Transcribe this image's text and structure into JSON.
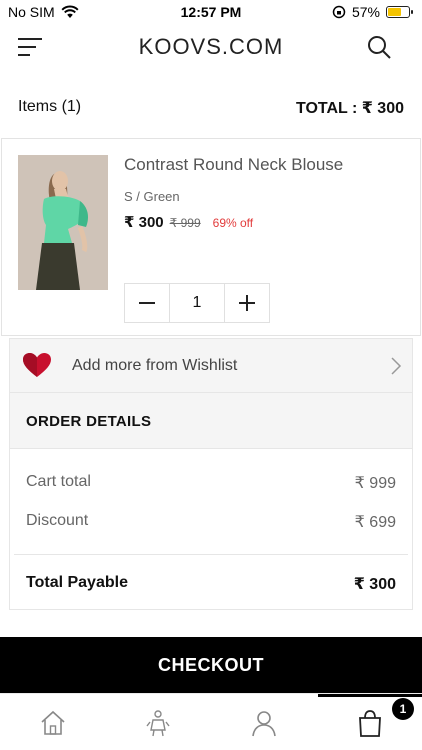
{
  "status_bar": {
    "carrier": "No SIM",
    "time": "12:57 PM",
    "battery": "57%",
    "battery_level": 0.57
  },
  "header": {
    "brand": "KOOVS.COM"
  },
  "summary": {
    "items_label": "Items (1)",
    "total_label": "TOTAL :  ₹ 300"
  },
  "cart_item": {
    "title": "Contrast Round Neck Blouse",
    "variant": "S / Green",
    "price": "₹ 300",
    "mrp": "₹ 999",
    "discount": "69% off",
    "quantity": "1",
    "decrease_icon": "minus-icon",
    "increase_icon": "plus-icon"
  },
  "wishlist": {
    "label": "Add more from Wishlist",
    "icon": "heart-icon",
    "color": "#c8102e"
  },
  "order_details": {
    "title": "ORDER DETAILS",
    "rows": [
      {
        "label": "Cart total",
        "value": "₹ 999"
      },
      {
        "label": "Discount",
        "value": "₹ 699"
      }
    ],
    "total": {
      "label": "Total Payable",
      "value": "₹ 300"
    }
  },
  "checkout": {
    "label": "CHECKOUT"
  },
  "bottom_nav": {
    "items": [
      {
        "icon": "home-icon"
      },
      {
        "icon": "lookbook-icon"
      },
      {
        "icon": "profile-icon"
      },
      {
        "icon": "bag-icon"
      }
    ],
    "cart_badge": "1"
  }
}
